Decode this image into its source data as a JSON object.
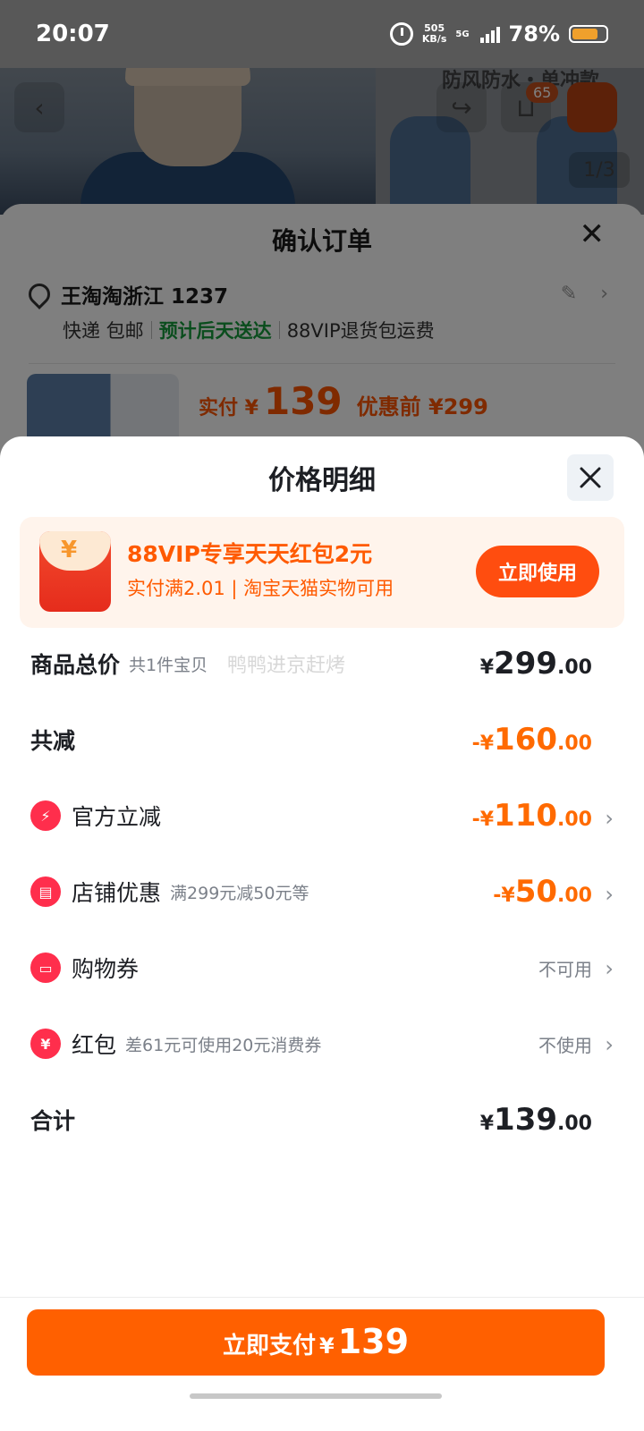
{
  "status_bar": {
    "time": "20:07",
    "net_speed_value": "505",
    "net_speed_unit": "KB/s",
    "network": "5G",
    "battery": "78%"
  },
  "background_page": {
    "caption": "防风防水・单冲款",
    "cart_badge": "65",
    "pager": "1/3"
  },
  "order_sheet": {
    "title": "确认订单",
    "address": "王淘淘浙江 1237",
    "shipping": "快递 包邮",
    "eta": "预计后天送达",
    "return_service": "88VIP退货包运费",
    "paid_label": "实付 ¥",
    "paid_value": "139",
    "before_label": "优惠前 ¥299"
  },
  "price_detail": {
    "title": "价格明细",
    "promo": {
      "title": "88VIP专享天天红包2元",
      "subtitle": "实付满2.01 | 淘宝天猫实物可用",
      "button": "立即使用",
      "icon_glyph": "¥"
    },
    "watermark": "鸭鸭进京赶烤",
    "rows": [
      {
        "label": "商品总价",
        "note": "共1件宝贝",
        "currency": "¥",
        "int": "299",
        "dec": ".00"
      },
      {
        "label": "共减",
        "note": "",
        "currency": "-¥",
        "int": "160",
        "dec": ".00"
      },
      {
        "label": "官方立减",
        "note": "",
        "currency": "-¥",
        "int": "110",
        "dec": ".00",
        "icon": "lightning-icon"
      },
      {
        "label": "店铺优惠",
        "note": "满299元减50元等",
        "currency": "-¥",
        "int": "50",
        "dec": ".00",
        "icon": "shop-icon"
      },
      {
        "label": "购物券",
        "note": "",
        "status": "不可用",
        "icon": "coupon-icon"
      },
      {
        "label": "红包",
        "note": "差61元可使用20元消费券",
        "status": "不使用",
        "icon": "red-packet-icon"
      },
      {
        "label": "合计",
        "note": "",
        "currency": "¥",
        "int": "139",
        "dec": ".00"
      }
    ]
  },
  "footer": {
    "pay_label": "立即支付",
    "pay_currency": "¥",
    "pay_amount": "139"
  },
  "colors": {
    "accent": "#ff6000",
    "promo_orange": "#ff5a00",
    "discount_orange": "#ff6a00",
    "eta_green": "#159a3b",
    "icon_red": "#ff2e4c"
  }
}
